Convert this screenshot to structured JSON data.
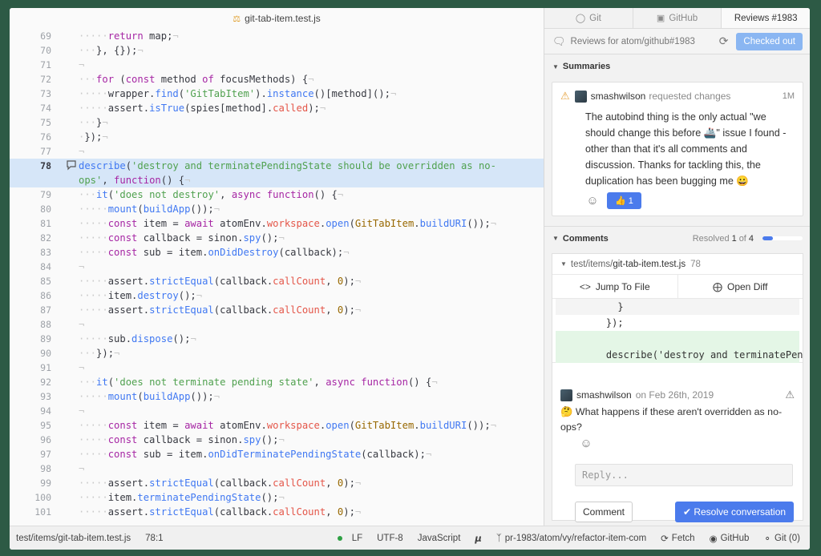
{
  "editor": {
    "tab_title": "git-tab-item.test.js",
    "lines": [
      {
        "num": "69",
        "html": "<span class=\"ws\">·····</span><span class=\"k\">return</span> map;<span class=\"ws\">¬</span>"
      },
      {
        "num": "70",
        "html": "<span class=\"ws\">···</span>}, {});<span class=\"ws\">¬</span>"
      },
      {
        "num": "71",
        "html": "<span class=\"ws\">¬</span>"
      },
      {
        "num": "72",
        "html": "<span class=\"ws\">···</span><span class=\"k\">for</span> (<span class=\"k\">const</span> method <span class=\"k\">of</span> focusMethods) {<span class=\"ws\">¬</span>"
      },
      {
        "num": "73",
        "html": "<span class=\"ws\">·····</span>wrapper.<span class=\"f\">find</span>(<span class=\"s\">'GitTabItem'</span>).<span class=\"f\">instance</span>()[method]();<span class=\"ws\">¬</span>"
      },
      {
        "num": "74",
        "html": "<span class=\"ws\">·····</span>assert.<span class=\"f\">isTrue</span>(spies[method].<span class=\"p\">called</span>);<span class=\"ws\">¬</span>"
      },
      {
        "num": "75",
        "html": "<span class=\"ws\">···</span>}<span class=\"ws\">¬</span>"
      },
      {
        "num": "76",
        "html": "<span class=\"ws\">·</span>});<span class=\"ws\">¬</span>"
      },
      {
        "num": "77",
        "html": "<span class=\"ws\">¬</span>"
      },
      {
        "num": "78",
        "hl": true,
        "icon": true,
        "html": "<span class=\"f\">describe</span>(<span class=\"s\">'destroy and terminatePendingState should be overridden as no-</span>"
      },
      {
        "num": "",
        "hl": true,
        "html": "<span class=\"s\">ops'</span>, <span class=\"k\">function</span>() {<span class=\"ws\">¬</span>"
      },
      {
        "num": "79",
        "html": "<span class=\"ws\">···</span><span class=\"f\">it</span>(<span class=\"s\">'does not destroy'</span>, <span class=\"k\">async function</span>() {<span class=\"ws\">¬</span>"
      },
      {
        "num": "80",
        "html": "<span class=\"ws\">·····</span><span class=\"f\">mount</span>(<span class=\"f\">buildApp</span>());<span class=\"ws\">¬</span>"
      },
      {
        "num": "81",
        "html": "<span class=\"ws\">·····</span><span class=\"k\">const</span> item = <span class=\"k\">await</span> atomEnv.<span class=\"p\">workspace</span>.<span class=\"f\">open</span>(<span class=\"n\">GitTabItem</span>.<span class=\"f\">buildURI</span>());<span class=\"ws\">¬</span>"
      },
      {
        "num": "82",
        "html": "<span class=\"ws\">·····</span><span class=\"k\">const</span> callback = sinon.<span class=\"f\">spy</span>();<span class=\"ws\">¬</span>"
      },
      {
        "num": "83",
        "html": "<span class=\"ws\">·····</span><span class=\"k\">const</span> sub = item.<span class=\"f\">onDidDestroy</span>(callback);<span class=\"ws\">¬</span>"
      },
      {
        "num": "84",
        "html": "<span class=\"ws\">¬</span>"
      },
      {
        "num": "85",
        "html": "<span class=\"ws\">·····</span>assert.<span class=\"f\">strictEqual</span>(callback.<span class=\"p\">callCount</span>, <span class=\"n\">0</span>);<span class=\"ws\">¬</span>"
      },
      {
        "num": "86",
        "html": "<span class=\"ws\">·····</span>item.<span class=\"f\">destroy</span>();<span class=\"ws\">¬</span>"
      },
      {
        "num": "87",
        "html": "<span class=\"ws\">·····</span>assert.<span class=\"f\">strictEqual</span>(callback.<span class=\"p\">callCount</span>, <span class=\"n\">0</span>);<span class=\"ws\">¬</span>"
      },
      {
        "num": "88",
        "html": "<span class=\"ws\">¬</span>"
      },
      {
        "num": "89",
        "html": "<span class=\"ws\">·····</span>sub.<span class=\"f\">dispose</span>();<span class=\"ws\">¬</span>"
      },
      {
        "num": "90",
        "html": "<span class=\"ws\">···</span>});<span class=\"ws\">¬</span>"
      },
      {
        "num": "91",
        "html": "<span class=\"ws\">¬</span>"
      },
      {
        "num": "92",
        "html": "<span class=\"ws\">···</span><span class=\"f\">it</span>(<span class=\"s\">'does not terminate pending state'</span>, <span class=\"k\">async function</span>() {<span class=\"ws\">¬</span>"
      },
      {
        "num": "93",
        "html": "<span class=\"ws\">·····</span><span class=\"f\">mount</span>(<span class=\"f\">buildApp</span>());<span class=\"ws\">¬</span>"
      },
      {
        "num": "94",
        "html": "<span class=\"ws\">¬</span>"
      },
      {
        "num": "95",
        "html": "<span class=\"ws\">·····</span><span class=\"k\">const</span> item = <span class=\"k\">await</span> atomEnv.<span class=\"p\">workspace</span>.<span class=\"f\">open</span>(<span class=\"n\">GitTabItem</span>.<span class=\"f\">buildURI</span>());<span class=\"ws\">¬</span>"
      },
      {
        "num": "96",
        "html": "<span class=\"ws\">·····</span><span class=\"k\">const</span> callback = sinon.<span class=\"f\">spy</span>();<span class=\"ws\">¬</span>"
      },
      {
        "num": "97",
        "html": "<span class=\"ws\">·····</span><span class=\"k\">const</span> sub = item.<span class=\"f\">onDidTerminatePendingState</span>(callback);<span class=\"ws\">¬</span>"
      },
      {
        "num": "98",
        "html": "<span class=\"ws\">¬</span>"
      },
      {
        "num": "99",
        "html": "<span class=\"ws\">·····</span>assert.<span class=\"f\">strictEqual</span>(callback.<span class=\"p\">callCount</span>, <span class=\"n\">0</span>);<span class=\"ws\">¬</span>"
      },
      {
        "num": "100",
        "html": "<span class=\"ws\">·····</span>item.<span class=\"f\">terminatePendingState</span>();<span class=\"ws\">¬</span>"
      },
      {
        "num": "101",
        "html": "<span class=\"ws\">·····</span>assert.<span class=\"f\">strictEqual</span>(callback.<span class=\"p\">callCount</span>, <span class=\"n\">0</span>);<span class=\"ws\">¬</span>"
      }
    ]
  },
  "panel": {
    "tabs": [
      {
        "label": "Git",
        "icon": "git-icon"
      },
      {
        "label": "GitHub",
        "icon": "github-icon"
      },
      {
        "label": "Reviews #1983",
        "icon": ""
      }
    ],
    "reviews_title": "Reviews for atom/github#1983",
    "checked_out_label": "Checked out",
    "summaries_label": "Summaries",
    "summary": {
      "author": "smashwilson",
      "action": "requested changes",
      "time": "1M",
      "body": "The autobind thing is the only actual \"we should change this before 🚢\" issue I found - other than that it's all comments and discussion. Thanks for tackling this, the duplication has been bugging me 😀",
      "thumbs_count": "1"
    },
    "comments_label": "Comments",
    "resolved_prefix": "Resolved",
    "resolved_count": "1",
    "resolved_of": "of",
    "resolved_total": "4",
    "resolved_fraction": 0.25,
    "thread": {
      "path_prefix": "test/items/",
      "path_file": "git-tab-item.test.js",
      "line": "78",
      "jump_label": "Jump To File",
      "open_diff_label": "Open Diff",
      "diff": [
        "      }",
        "    });",
        "",
        "    describe('destroy and terminatePen"
      ],
      "author": "smashwilson",
      "date": "on Feb 26th, 2019",
      "body": "🤔 What happens if these aren't overridden as no-ops?",
      "reply_placeholder": "Reply...",
      "comment_label": "Comment",
      "resolve_label": "✔ Resolve conversation"
    }
  },
  "status": {
    "path": "test/items/git-tab-item.test.js",
    "cursor": "78:1",
    "line_ending": "LF",
    "encoding": "UTF-8",
    "grammar": "JavaScript",
    "branch": "pr-1983/atom/vy/refactor-item-com",
    "fetch": "Fetch",
    "github": "GitHub",
    "git": "Git (0)"
  },
  "colors": {
    "accent": "#4b7bec",
    "highlight": "#d6e6f8",
    "background": "#2d5a45"
  }
}
